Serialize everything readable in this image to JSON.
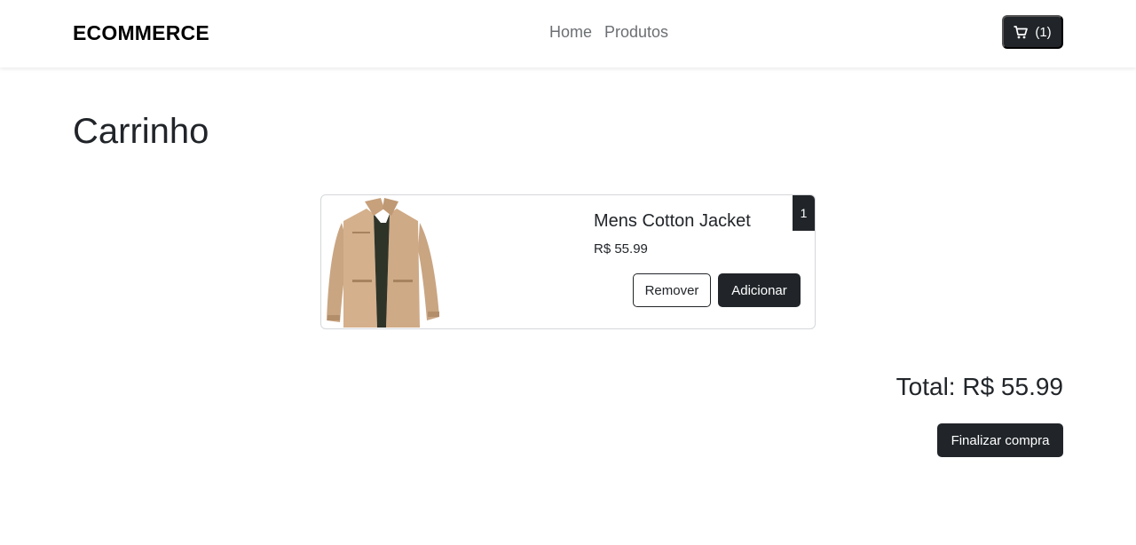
{
  "navbar": {
    "brand": "ECOMMERCE",
    "links": [
      "Home",
      "Produtos"
    ],
    "cart": {
      "icon": "cart-icon",
      "count_label": "(1)"
    }
  },
  "page": {
    "title": "Carrinho"
  },
  "cart_items": [
    {
      "name": "Mens Cotton Jacket",
      "price": "R$ 55.99",
      "quantity": "1",
      "image": "jacket-image",
      "remove_label": "Remover",
      "add_label": "Adicionar"
    }
  ],
  "summary": {
    "total_label": "Total: R$ 55.99",
    "checkout_label": "Finalizar compra"
  },
  "colors": {
    "dark": "#212529",
    "nav_link": "#6c6f73",
    "border": "#d5d7da"
  }
}
